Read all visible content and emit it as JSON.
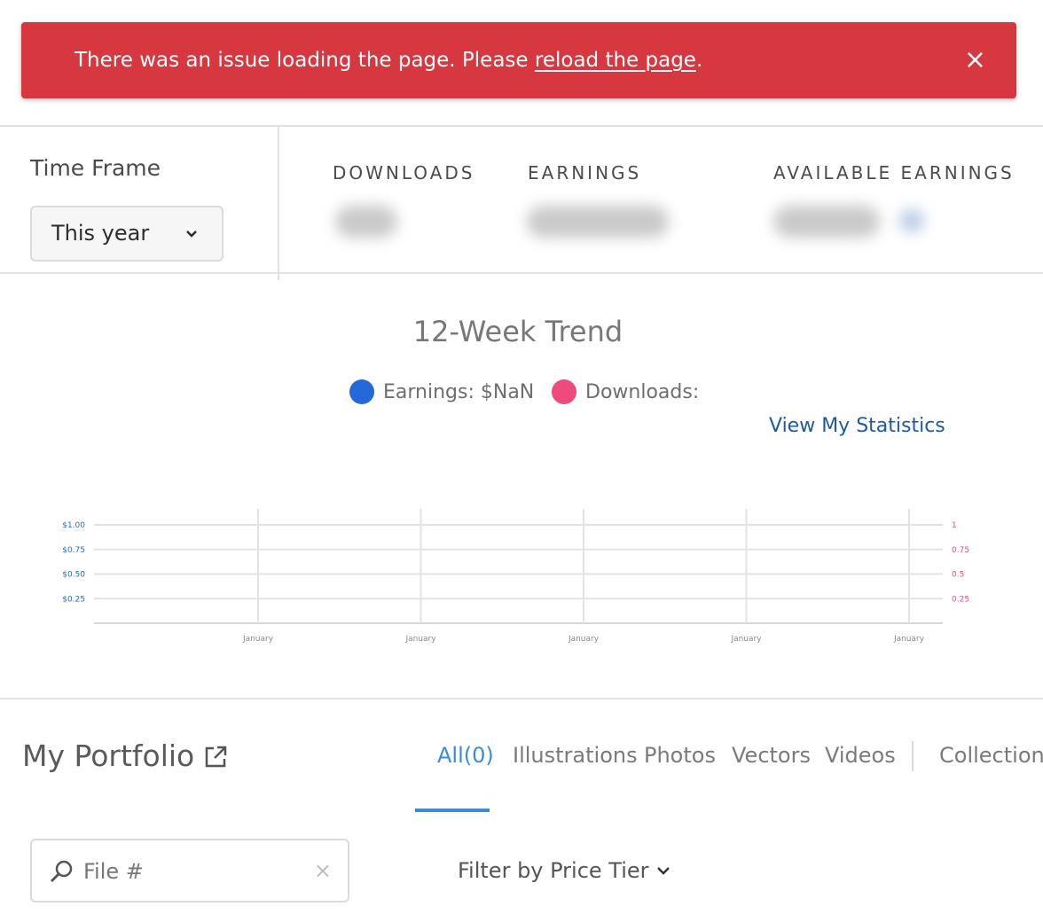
{
  "alert": {
    "message": "There was an issue loading the page. Please ",
    "link_text": "reload the page",
    "suffix": ".",
    "close_label": "×",
    "bg_color": "#d7373f"
  },
  "time_frame": {
    "label": "Time Frame",
    "selected": "This year",
    "chevron_icon": "chevron-down-icon"
  },
  "stats": {
    "downloads_label": "DOWNLOADS",
    "earnings_label": "EARNINGS",
    "available_earnings_label": "AVAILABLE EARNINGS"
  },
  "trend": {
    "title": "12-Week Trend",
    "legend_earnings": "Earnings: $NaN",
    "legend_downloads": "Downloads:",
    "earnings_color": "#2469d9",
    "downloads_color": "#ef4a7e",
    "view_stats_link": "View My Statistics"
  },
  "chart_data": {
    "type": "line",
    "x": [
      "January",
      "January",
      "January",
      "January",
      "January"
    ],
    "series": [
      {
        "values": [],
        "color": "#2469d9",
        "axis": "left"
      },
      {
        "values": [],
        "color": "#ef4a7e",
        "axis": "right"
      }
    ],
    "left_ticks": [
      "$1.00",
      "$0.75",
      "$0.50",
      "$0.25"
    ],
    "right_ticks": [
      "1",
      "0.75",
      "0.5",
      "0.25"
    ],
    "ylim": [
      0,
      1
    ],
    "grid": true
  },
  "portfolio": {
    "title": "My Portfolio",
    "external_icon": "external-link-icon",
    "tabs": [
      {
        "label": "All(0)",
        "active": true
      },
      {
        "label": "Illustrations",
        "active": false
      },
      {
        "label": "Photos",
        "active": false
      },
      {
        "label": "Vectors",
        "active": false
      },
      {
        "label": "Videos",
        "active": false
      },
      {
        "label": "Collections",
        "active": false
      }
    ],
    "search_placeholder": "File #",
    "search_clear": "×",
    "filter_label": "Filter by Price Tier",
    "filter_chevron": "chevron-down-icon"
  }
}
